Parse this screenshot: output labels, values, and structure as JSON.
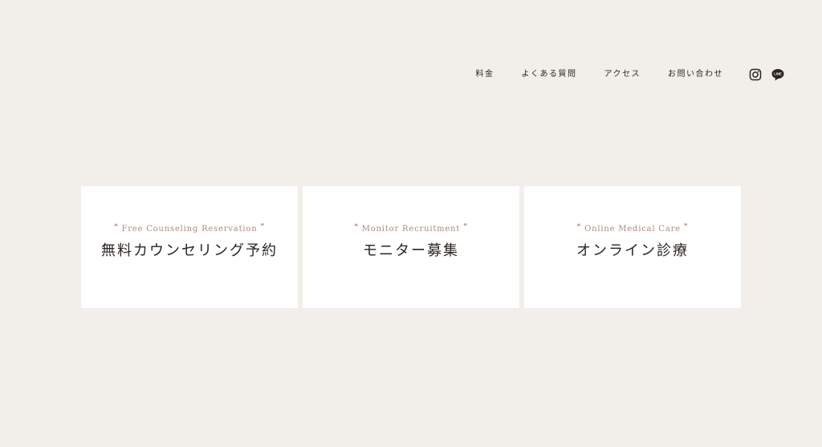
{
  "nav": {
    "items": [
      {
        "label": "料金"
      },
      {
        "label": "よくある質問"
      },
      {
        "label": "アクセス"
      },
      {
        "label": "お問い合わせ"
      }
    ],
    "social": [
      {
        "icon": "instagram-icon"
      },
      {
        "icon": "line-icon",
        "text": "LINE"
      }
    ]
  },
  "quotes": {
    "open": "❝",
    "close": "❞"
  },
  "cards": [
    {
      "subtitle": "Free Counseling Reservation",
      "title": "無料カウンセリング予約"
    },
    {
      "subtitle": "Monitor Recruitment",
      "title": "モニター募集"
    },
    {
      "subtitle": "Online Medical Care",
      "title": "オンライン診療"
    }
  ],
  "colors": {
    "background": "#f2efeb",
    "card": "#ffffff",
    "accent": "#b0897b",
    "text": "#2b2522"
  }
}
